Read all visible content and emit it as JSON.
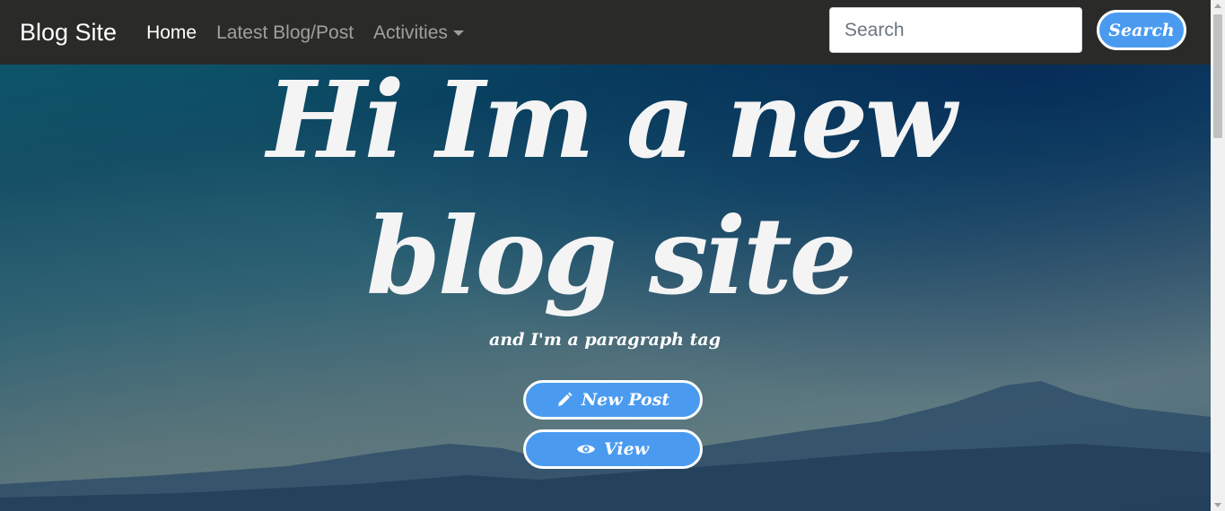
{
  "navbar": {
    "brand": "Blog Site",
    "links": [
      {
        "label": "Home",
        "active": true
      },
      {
        "label": "Latest Blog/Post",
        "active": false
      },
      {
        "label": "Activities",
        "active": false,
        "dropdown": true
      }
    ],
    "search": {
      "placeholder": "Search",
      "button_label": "Search"
    }
  },
  "hero": {
    "headline_line1": "Hi Im a new",
    "headline_line2": "blog site",
    "subtitle": "and I'm a paragraph tag",
    "buttons": [
      {
        "label": "New Post",
        "icon": "pencil-icon"
      },
      {
        "label": "View",
        "icon": "eye-icon"
      }
    ]
  },
  "colors": {
    "navbar_bg": "#2a2b28",
    "button_bg": "#4a9bf0",
    "text": "#f4f4f4"
  }
}
